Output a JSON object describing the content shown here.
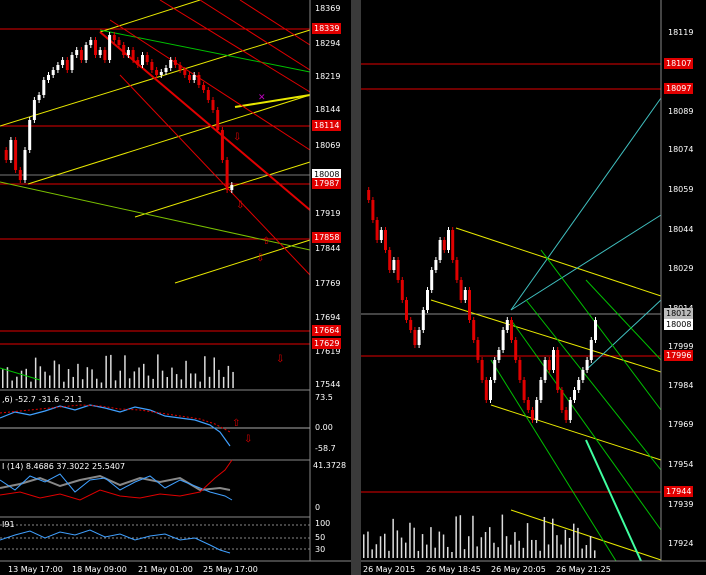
{
  "left": {
    "price_labels": [
      "18369",
      "18294",
      "18219",
      "18144",
      "18069",
      "17919",
      "17844",
      "17769",
      "17694",
      "17619",
      "17544"
    ],
    "tags": {
      "t18339": "18339",
      "t18114": "18114",
      "t18008": "18008",
      "t17987": "17987",
      "t17858": "17858",
      "t17664": "17664",
      "t17629": "17629"
    },
    "macd_label": ",6) -52.7 -31.6 -21.1",
    "macd_scale": {
      "top": "73.5",
      "zero": "0.00",
      "bottom": "-58.7"
    },
    "ind2_label": "I (14) 8.4686 37.3022 25.5407",
    "ind2_scale": {
      "top": "41.3728",
      "zero": "0"
    },
    "ind3_label": "I91",
    "ind3_scale": {
      "a": "100",
      "b": "50",
      "c": "30"
    },
    "time_labels": [
      "13 May 17:00",
      "18 May 09:00",
      "21 May 01:00",
      "25 May 17:00"
    ]
  },
  "right": {
    "price_labels": [
      "18119",
      "18089",
      "18074",
      "18059",
      "18044",
      "18029",
      "18014",
      "17999",
      "17984",
      "17969",
      "17954",
      "17939",
      "17924"
    ],
    "tags": {
      "t18107": "18107",
      "t18097": "18097",
      "t18012": "18012",
      "t18008": "18008",
      "t17996": "17996",
      "t17944": "17944"
    },
    "time_labels": [
      "26 May 2015",
      "26 May 18:45",
      "26 May 20:05",
      "26 May 21:25"
    ]
  },
  "colors": {
    "bull": "#ffffff",
    "bear": "#e00000",
    "yellow": "#e8e800",
    "red_line": "#e00000",
    "green": "#00c000",
    "cyan": "#40c0c0"
  }
}
